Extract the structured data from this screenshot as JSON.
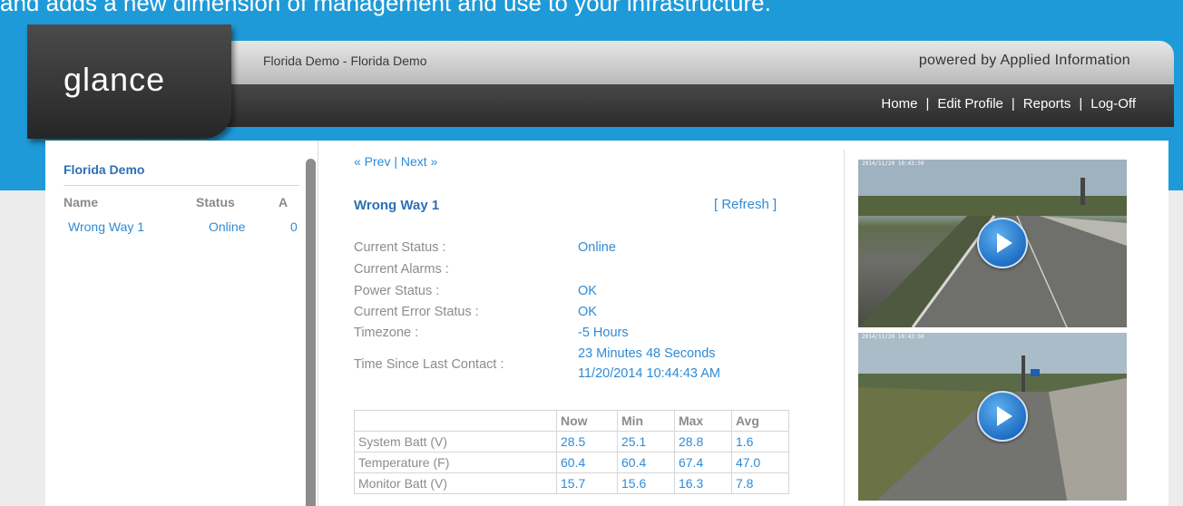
{
  "tagline": "and adds a new dimension of management and use to your infrastructure.",
  "brand": {
    "logo": "glance",
    "powered_by": "powered by Applied Information"
  },
  "header": {
    "breadcrumb": "Florida Demo - Florida Demo"
  },
  "nav": {
    "items": [
      {
        "label": "Home"
      },
      {
        "label": "Edit Profile"
      },
      {
        "label": "Reports"
      },
      {
        "label": "Log-Off"
      }
    ],
    "separator": "|"
  },
  "sidebar": {
    "title": "Florida Demo",
    "columns": [
      "Name",
      "Status",
      "A"
    ],
    "rows": [
      {
        "name": "Wrong Way 1",
        "status": "Online",
        "alarms": "0"
      }
    ]
  },
  "pager": {
    "prev": "« Prev",
    "separator": "|",
    "next": "Next »"
  },
  "device": {
    "title": "Wrong Way 1",
    "refresh_open": "[",
    "refresh": "Refresh",
    "refresh_close": "]",
    "fields": [
      {
        "label": "Current Status :",
        "value": "Online"
      },
      {
        "label": "Current Alarms :",
        "value": ""
      },
      {
        "label": "Power Status :",
        "value": "OK"
      },
      {
        "label": "Current Error Status :",
        "value": "OK"
      },
      {
        "label": "Timezone :",
        "value": "-5 Hours"
      }
    ],
    "last_contact": {
      "label": "Time Since Last Contact :",
      "elapsed": "23 Minutes 48 Seconds",
      "timestamp": "11/20/2014 10:44:43 AM"
    }
  },
  "stats": {
    "columns": [
      "",
      "Now",
      "Min",
      "Max",
      "Avg"
    ],
    "rows": [
      {
        "label": "System Batt (V)",
        "now": "28.5",
        "min": "25.1",
        "max": "28.8",
        "avg": "1.6"
      },
      {
        "label": "Temperature (F)",
        "now": "60.4",
        "min": "60.4",
        "max": "67.4",
        "avg": "47.0"
      },
      {
        "label": "Monitor Batt (V)",
        "now": "15.7",
        "min": "15.6",
        "max": "16.3",
        "avg": "7.8"
      }
    ]
  },
  "cameras": [
    {
      "timestamp": "2014/11/20 10:43:50",
      "play_icon": "play-icon"
    },
    {
      "timestamp": "2014/11/20 10:43:50",
      "play_icon": "play-icon"
    }
  ],
  "colors": {
    "accent_blue": "#1e9ad8",
    "link_blue": "#2e8bd6",
    "title_blue": "#2e6fb5"
  }
}
